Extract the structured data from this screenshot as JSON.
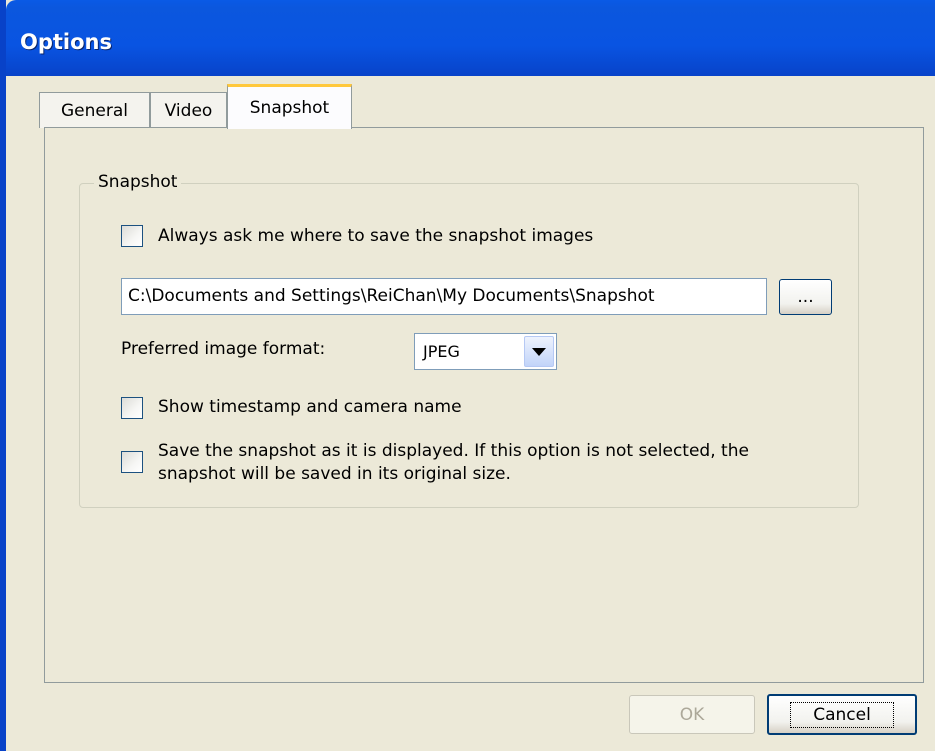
{
  "window": {
    "title": "Options"
  },
  "tabs": [
    {
      "label": "General",
      "active": false
    },
    {
      "label": "Video",
      "active": false
    },
    {
      "label": "Snapshot",
      "active": true
    }
  ],
  "snapshot_group": {
    "label": "Snapshot",
    "always_ask": {
      "label": "Always ask me where to save the snapshot images",
      "checked": false
    },
    "path": {
      "value": "C:\\Documents and Settings\\ReiChan\\My Documents\\Snapshot"
    },
    "browse_label": "...",
    "format": {
      "label": "Preferred image format:",
      "value": "JPEG"
    },
    "timestamp": {
      "label": "Show timestamp and camera name",
      "checked": false
    },
    "save_as_displayed": {
      "label_line1": "Save the snapshot as it is displayed. If this option is not selected, the",
      "label_line2": "snapshot will be saved in its original size.",
      "checked": false
    }
  },
  "buttons": {
    "ok_label": "OK",
    "ok_enabled": false,
    "cancel_label": "Cancel"
  },
  "colors": {
    "title_bar": "#0954e2",
    "dialog_bg": "#ece9d8",
    "active_tab_highlight": "#ffc83c"
  }
}
